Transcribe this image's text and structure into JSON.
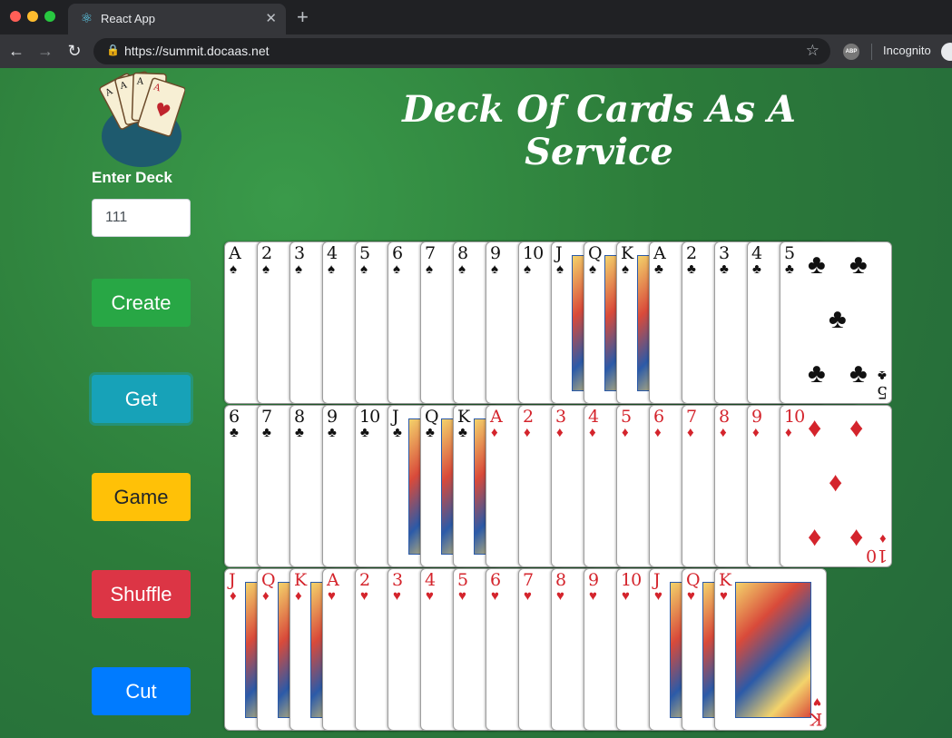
{
  "browser": {
    "tab_title": "React App",
    "url": "https://summit.docaas.net",
    "profile_label": "Incognito",
    "extension_label": "ABP"
  },
  "page": {
    "title": "Deck Of Cards As A Service",
    "deck_label": "Enter Deck",
    "deck_value": "111"
  },
  "buttons": {
    "create": "Create",
    "get": "Get",
    "game": "Game",
    "shuffle": "Shuffle",
    "cut": "Cut"
  },
  "colors": {
    "table_green": "#2e7d3e",
    "create": "#28a745",
    "get": "#17a2b8",
    "game": "#ffc107",
    "shuffle": "#dc3545",
    "cut": "#007bff",
    "red_suit": "#d4242c"
  },
  "cards": {
    "rows": [
      [
        "A♠",
        "2♠",
        "3♠",
        "4♠",
        "5♠",
        "6♠",
        "7♠",
        "8♠",
        "9♠",
        "10♠",
        "J♠",
        "Q♠",
        "K♠",
        "A♣",
        "2♣",
        "3♣",
        "4♣",
        "5♣"
      ],
      [
        "6♣",
        "7♣",
        "8♣",
        "9♣",
        "10♣",
        "J♣",
        "Q♣",
        "K♣",
        "A♦",
        "2♦",
        "3♦",
        "4♦",
        "5♦",
        "6♦",
        "7♦",
        "8♦",
        "9♦",
        "10♦"
      ],
      [
        "J♦",
        "Q♦",
        "K♦",
        "A♥",
        "2♥",
        "3♥",
        "4♥",
        "5♥",
        "6♥",
        "7♥",
        "8♥",
        "9♥",
        "10♥",
        "J♥",
        "Q♥",
        "K♥"
      ]
    ]
  }
}
